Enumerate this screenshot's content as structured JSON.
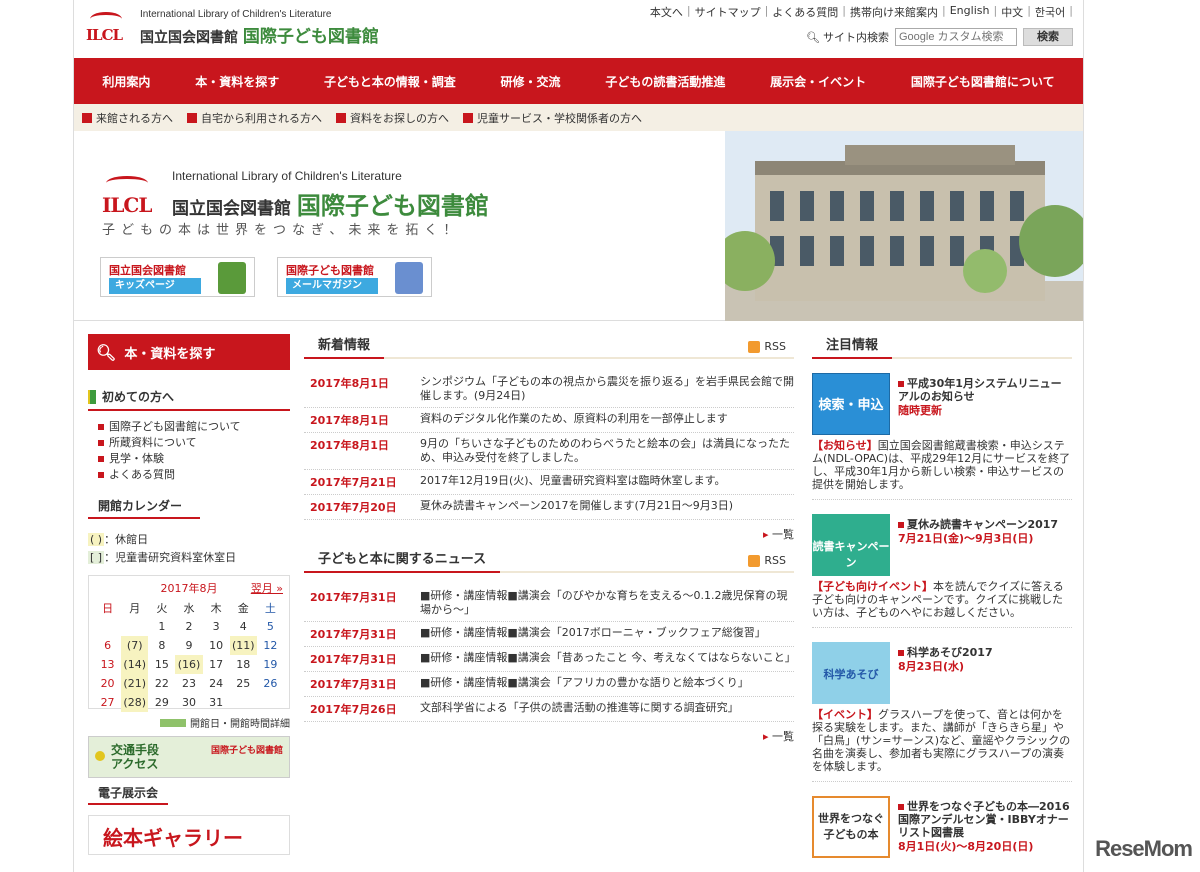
{
  "header": {
    "logo_en": "International Library of Children's Literature",
    "logo_jp_a": "国立国会図書館",
    "logo_jp_b": "国際子ども図書館",
    "logo_mark": "ILCL",
    "top_links": [
      "本文へ",
      "サイトマップ",
      "よくある質問",
      "携帯向け来館案内",
      "English",
      "中文",
      "한국어"
    ],
    "search_label": "サイト内検索",
    "search_placeholder": "Google カスタム検索",
    "search_button": "検索"
  },
  "nav": [
    "利用案内",
    "本・資料を探す",
    "子どもと本の情報・調査",
    "研修・交流",
    "子どもの読書活動推進",
    "展示会・イベント",
    "国際子ども図書館について"
  ],
  "subnav": [
    "来館される方へ",
    "自宅から利用される方へ",
    "資料をお探しの方へ",
    "児童サービス・学校関係者の方へ"
  ],
  "hero": {
    "slogan": "子どもの本は世界をつなぎ、未来を拓く！",
    "btn1_t1": "国立国会図書館",
    "btn1_t2": "キッズページ",
    "btn2_t1": "国際子ども図書館",
    "btn2_t2": "メールマガジン"
  },
  "left": {
    "search_head": "本・資料を探す",
    "first_title": "初めての方へ",
    "first_items": [
      "国際子ども図書館について",
      "所蔵資料について",
      "見学・体験",
      "よくある質問"
    ],
    "cal_title": "開館カレンダー",
    "legend1_mark": "( )",
    "legend1": "：休館日",
    "legend2_mark": "[ ]",
    "legend2": "：児童書研究資料室休室日",
    "cal_month": "2017年8月",
    "cal_next": "翌月 »",
    "weekdays": [
      "日",
      "月",
      "火",
      "水",
      "木",
      "金",
      "土"
    ],
    "weeks": [
      [
        "",
        "",
        "1",
        "2",
        "3",
        "4",
        "5"
      ],
      [
        "6",
        "(7)",
        "8",
        "9",
        "10",
        "(11)",
        "12"
      ],
      [
        "13",
        "(14)",
        "15",
        "(16)",
        "17",
        "18",
        "19"
      ],
      [
        "20",
        "(21)",
        "22",
        "23",
        "24",
        "25",
        "26"
      ],
      [
        "27",
        "(28)",
        "29",
        "30",
        "31",
        "",
        ""
      ]
    ],
    "cal_note": "開館日・開館時間詳細",
    "access_t1": "交通手段",
    "access_t2": "アクセス",
    "access_lib": "国際子ども図書館",
    "exhibit_title": "電子展示会",
    "ehon": "絵本ギャラリー"
  },
  "news": {
    "title": "新着情報",
    "rss": "RSS",
    "more": "一覧",
    "items": [
      {
        "date": "2017年8月1日",
        "text": "シンポジウム「子どもの本の視点から震災を振り返る」を岩手県民会館で開催します。(9月24日)"
      },
      {
        "date": "2017年8月1日",
        "text": "資料のデジタル化作業のため、原資料の利用を一部停止します"
      },
      {
        "date": "2017年8月1日",
        "text": "9月の「ちいさな子どものためのわらべうたと絵本の会」は満員になったため、申込み受付を終了しました。"
      },
      {
        "date": "2017年7月21日",
        "text": "2017年12月19日(火)、児童書研究資料室は臨時休室します。"
      },
      {
        "date": "2017年7月20日",
        "text": "夏休み読書キャンペーン2017を開催します(7月21日～9月3日)"
      }
    ]
  },
  "kidsnews": {
    "title": "子どもと本に関するニュース",
    "rss": "RSS",
    "more": "一覧",
    "items": [
      {
        "date": "2017年7月31日",
        "text": "■研修・講座情報■講演会「のびやかな育ちを支える～0.1.2歳児保育の現場から～」"
      },
      {
        "date": "2017年7月31日",
        "text": "■研修・講座情報■講演会「2017ボローニャ・ブックフェア総復習」"
      },
      {
        "date": "2017年7月31日",
        "text": "■研修・講座情報■講演会「昔あったこと 今、考えなくてはならないこと」"
      },
      {
        "date": "2017年7月31日",
        "text": "■研修・講座情報■講演会「アフリカの豊かな語りと絵本づくり」"
      },
      {
        "date": "2017年7月26日",
        "text": "文部科学省による「子供の読書活動の推進等に関する調査研究」"
      }
    ]
  },
  "featured": {
    "title": "注目情報",
    "items": [
      {
        "title": "平成30年1月システムリニューアルのお知らせ",
        "date": "随時更新",
        "tag": "【お知らせ】",
        "desc": "国立国会図書館蔵書検索・申込システム(NDL-OPAC)は、平成29年12月にサービスを終了し、平成30年1月から新しい検索・申込サービスの提供を開始します。",
        "img": "検索・申込"
      },
      {
        "title": "夏休み読書キャンペーン2017",
        "date": "7月21日(金)～9月3日(日)",
        "tag": "【子ども向けイベント】",
        "desc": "本を読んでクイズに答える子ども向けのキャンペーンです。クイズに挑戦したい方は、子どものへやにお越しください。",
        "img": "読書キャンペーン"
      },
      {
        "title": "科学あそび2017",
        "date": "8月23日(水)",
        "tag": "【イベント】",
        "desc": "グラスハープを使って、音とは何かを探る実験をします。また、講師が「きらきら星」や「白鳥」(サン=サーンス)など、童謡やクラシックの名曲を演奏し、参加者も実際にグラスハープの演奏を体験します。",
        "img": "科学あそび"
      },
      {
        "title": "世界をつなぐ子どもの本―2016国際アンデルセン賞・IBBYオナーリスト図書展",
        "date": "8月1日(火)～8月20日(日)",
        "img": "世界をつなぐ子どもの本"
      }
    ]
  },
  "watermark": "ReseMom"
}
